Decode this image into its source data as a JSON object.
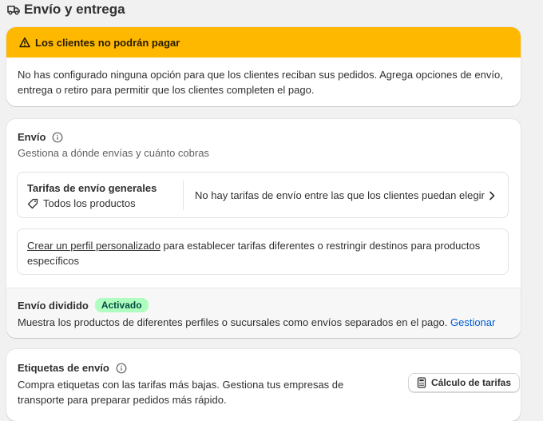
{
  "header": {
    "title": "Envío y entrega",
    "icon": "truck-icon"
  },
  "banner": {
    "title": "Los clientes no podrán pagar",
    "body": "No has configurado ninguna opción para que los clientes reciban sus pedidos. Agrega opciones de envío, entrega o retiro para permitir que los clientes completen el pago.",
    "color": "#ffb800",
    "icon": "warning-icon"
  },
  "shipping": {
    "title": "Envío",
    "subtitle": "Gestiona a dónde envías y cuánto cobras",
    "general_rates": {
      "title": "Tarifas de envío generales",
      "products": "Todos los productos",
      "message": "No hay tarifas de envío entre las que los clientes puedan elegir"
    },
    "custom_profile": {
      "link": "Crear un perfil personalizado",
      "text": " para establecer tarifas diferentes o restringir destinos para productos específicos"
    },
    "split": {
      "title": "Envío dividido",
      "badge": "Activado",
      "badge_color": "#affebf",
      "description": "Muestra los productos de diferentes perfiles o sucursales como envíos separados en el pago. ",
      "manage_link": "Gestionar"
    }
  },
  "labels": {
    "title": "Etiquetas de envío",
    "description": "Compra etiquetas con las tarifas más bajas. Gestiona tus empresas de transporte para preparar pedidos más rápido.",
    "button": "Cálculo de tarifas"
  }
}
